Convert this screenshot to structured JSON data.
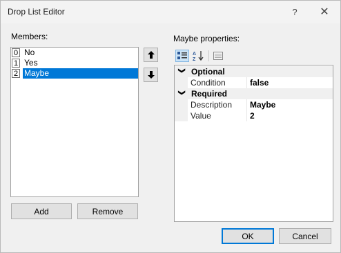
{
  "window": {
    "title": "Drop List Editor",
    "help_glyph": "?",
    "close_glyph": "✕"
  },
  "members": {
    "label": "Members:",
    "items": [
      {
        "index": "0",
        "label": "No"
      },
      {
        "index": "1",
        "label": "Yes"
      },
      {
        "index": "2",
        "label": "Maybe"
      }
    ],
    "selected": 2,
    "add_label": "Add",
    "remove_label": "Remove"
  },
  "move_buttons": {
    "up_glyph": "🡅",
    "down_glyph": "🡇"
  },
  "properties": {
    "label": "Maybe properties:",
    "categories": [
      {
        "name": "Optional",
        "props": [
          {
            "name": "Condition",
            "value": "false"
          }
        ]
      },
      {
        "name": "Required",
        "props": [
          {
            "name": "Description",
            "value": "Maybe"
          },
          {
            "name": "Value",
            "value": "2"
          }
        ]
      }
    ]
  },
  "footer": {
    "ok_label": "OK",
    "cancel_label": "Cancel"
  },
  "colors": {
    "selection": "#0078d7",
    "window_bg": "#f0f0f0"
  }
}
